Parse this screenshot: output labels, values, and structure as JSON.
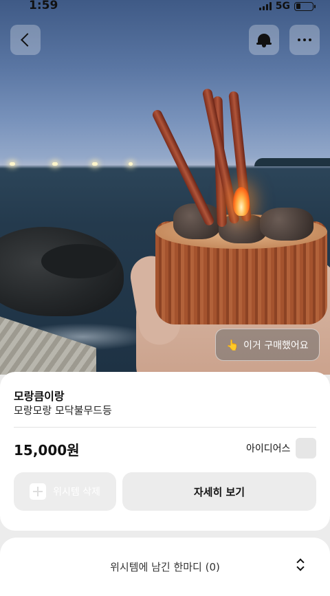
{
  "status_bar": {
    "time": "1:59",
    "network": "5G",
    "battery_level": 0.28
  },
  "photo_overlay": {
    "bought_label": "이거 구매했어요",
    "bought_icon": "pointing-hand-icon"
  },
  "product": {
    "brand": "모랑큼이랑",
    "name": "모랑모랑 모닥불무드등",
    "price": "15,000원",
    "seller": "아이디어스"
  },
  "actions": {
    "remove_wishlist": "위시템 삭제",
    "view_details": "자세히 보기"
  },
  "comments": {
    "label": "위시템에 남긴 한마디 (0)"
  },
  "colors": {
    "card": "#ffffff",
    "background": "#ececec",
    "button": "#ececec"
  }
}
